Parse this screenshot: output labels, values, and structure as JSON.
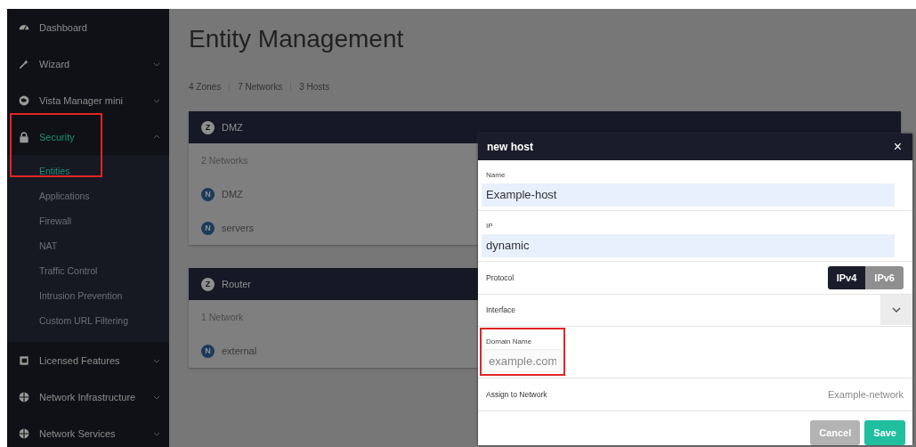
{
  "sidebar": {
    "items": [
      {
        "label": "Dashboard",
        "kind": "link",
        "selected": false
      },
      {
        "label": "Wizard",
        "kind": "group",
        "expanded": false,
        "selected": false
      },
      {
        "label": "Vista Manager mini",
        "kind": "group",
        "expanded": false,
        "selected": false
      },
      {
        "label": "Security",
        "kind": "group",
        "expanded": true,
        "selected": true,
        "highlighted": true,
        "children": [
          {
            "label": "Entities",
            "selected": true
          },
          {
            "label": "Applications",
            "selected": false
          },
          {
            "label": "Firewall",
            "selected": false
          },
          {
            "label": "NAT",
            "selected": false
          },
          {
            "label": "Traffic Control",
            "selected": false
          },
          {
            "label": "Intrusion Prevention",
            "selected": false
          },
          {
            "label": "Custom URL Filtering",
            "selected": false
          }
        ]
      },
      {
        "label": "Licensed Features",
        "kind": "group",
        "expanded": false,
        "selected": false
      },
      {
        "label": "Network Infrastructure",
        "kind": "group",
        "expanded": false,
        "selected": false
      },
      {
        "label": "Network Services",
        "kind": "group",
        "expanded": false,
        "selected": false
      }
    ]
  },
  "page": {
    "title": "Entity Management",
    "counts": [
      "4 Zones",
      "7 Networks",
      "3 Hosts"
    ],
    "zones": [
      {
        "badge": "Z",
        "name": "DMZ",
        "summary": "2 Networks",
        "networks": [
          {
            "badge": "N",
            "name": "DMZ"
          },
          {
            "badge": "N",
            "name": "servers"
          }
        ]
      },
      {
        "badge": "Z",
        "name": "Router",
        "summary": "1 Network",
        "networks": [
          {
            "badge": "N",
            "name": "external"
          }
        ]
      }
    ]
  },
  "dialog": {
    "title": "new host",
    "close": "×",
    "fields": [
      {
        "kind": "text",
        "label": "Name",
        "value": "Example-host",
        "autofilled": true
      },
      {
        "kind": "text",
        "label": "IP",
        "value": "dynamic",
        "autofilled": true
      },
      {
        "kind": "toggle",
        "label": "Protocol",
        "options": [
          {
            "label": "IPv4",
            "selected": true
          },
          {
            "label": "IPv6",
            "selected": false
          }
        ]
      },
      {
        "kind": "select",
        "label": "Interface"
      },
      {
        "kind": "text",
        "label": "Domain Name",
        "placeholder": "example.com",
        "autofilled": false,
        "highlighted": true
      },
      {
        "kind": "link",
        "label": "Assign to Network",
        "value": "Example-network"
      }
    ],
    "buttons": [
      {
        "label": "Cancel",
        "kind": "secondary"
      },
      {
        "label": "Save",
        "kind": "primary"
      }
    ]
  }
}
